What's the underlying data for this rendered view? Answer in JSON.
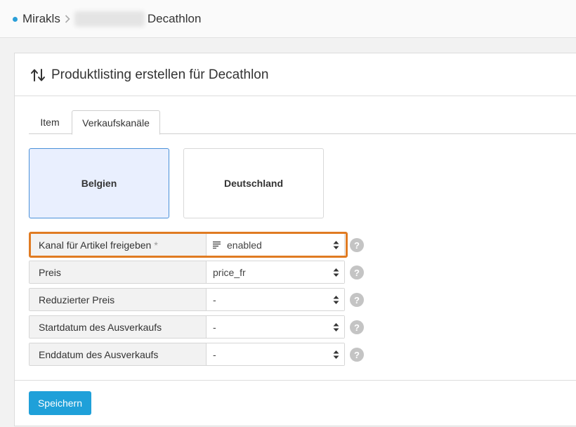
{
  "breadcrumb": {
    "root": "Mirakls",
    "current": "Decathlon"
  },
  "panel": {
    "title": "Produktlisting erstellen für Decathlon"
  },
  "tabs": [
    {
      "label": "Item",
      "active": false
    },
    {
      "label": "Verkaufskanäle",
      "active": true
    }
  ],
  "channels": [
    {
      "label": "Belgien",
      "active": true
    },
    {
      "label": "Deutschland",
      "active": false
    }
  ],
  "form": {
    "rows": [
      {
        "label": "Kanal für Artikel freigeben",
        "required_mark": "*",
        "value": "enabled",
        "icon": "list-icon"
      },
      {
        "label": "Preis",
        "value": "price_fr"
      },
      {
        "label": "Reduzierter Preis",
        "value": "-"
      },
      {
        "label": "Startdatum des Ausverkaufs",
        "value": "-"
      },
      {
        "label": "Enddatum des Ausverkaufs",
        "value": "-"
      }
    ],
    "help_glyph": "?"
  },
  "footer": {
    "save_label": "Speichern"
  },
  "colors": {
    "accent": "#1fa0d9",
    "highlight": "#e07b22",
    "active_card_bg": "#e9effe",
    "active_card_border": "#4a90d9"
  }
}
